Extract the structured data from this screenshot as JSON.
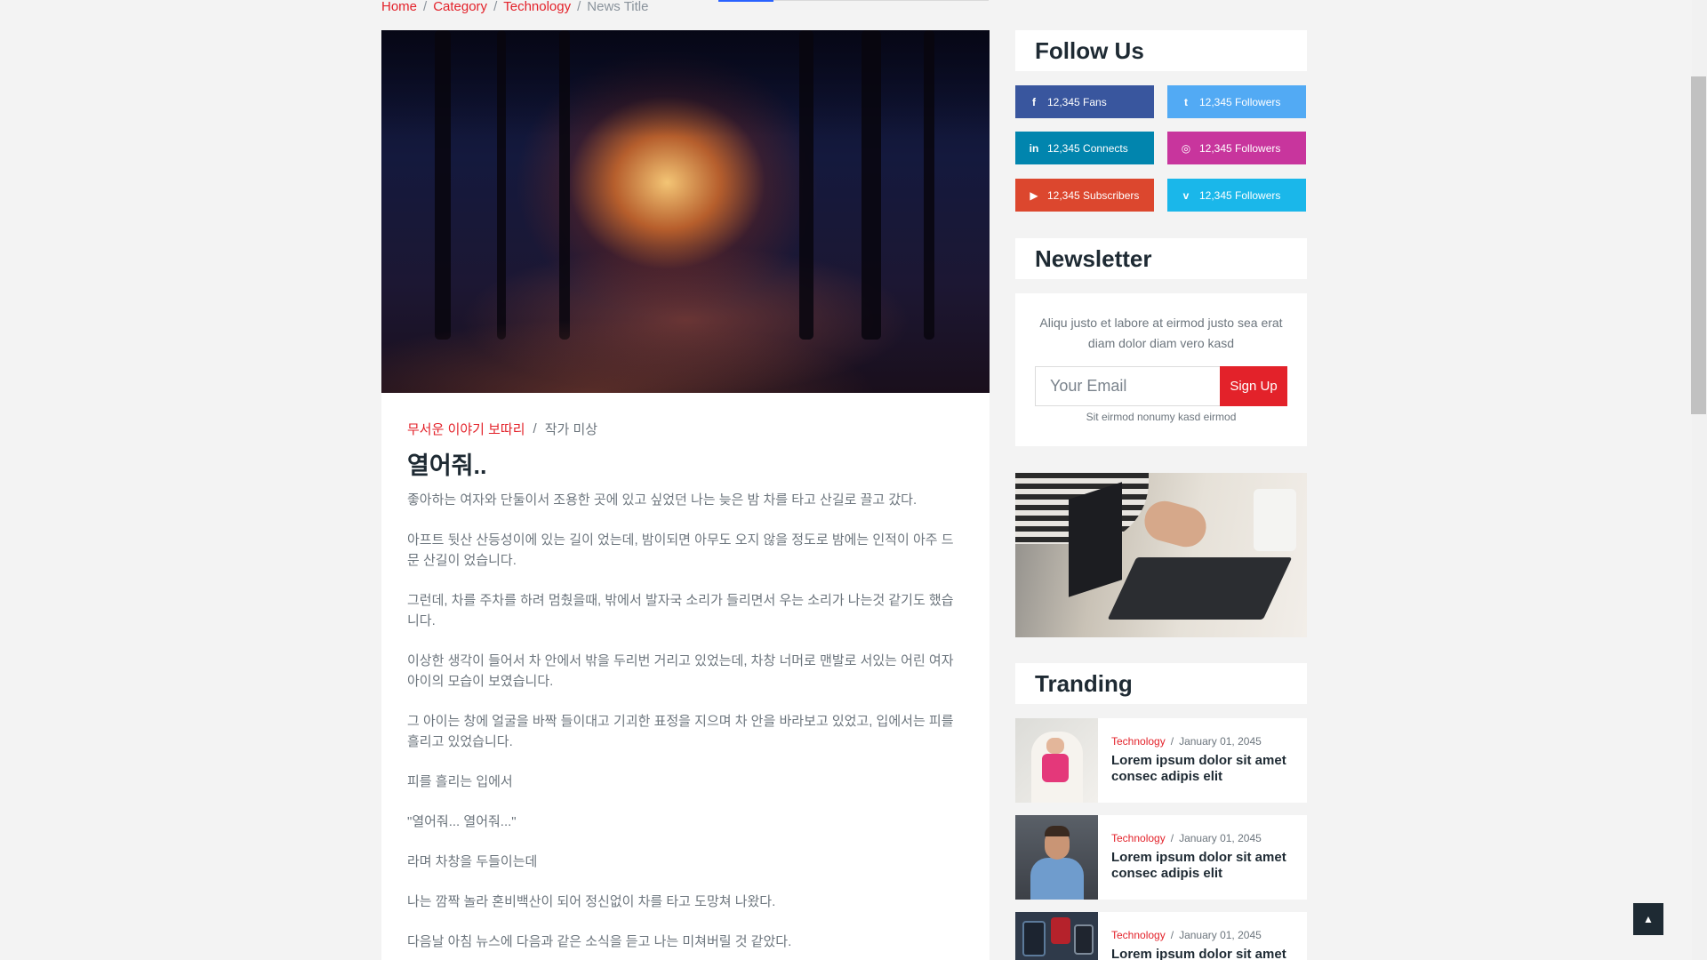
{
  "breadcrumb": {
    "home": "Home",
    "category": "Category",
    "technology": "Technology",
    "current": "News Title",
    "separator": "/"
  },
  "article": {
    "category": "무서운 이야기 보따리",
    "author": "작가 미상",
    "separator": "/",
    "title": "열어줘..",
    "paragraphs": [
      "좋아하는 여자와 단둘이서 조용한 곳에 있고 싶었던 나는 늦은 밤 차를 타고 산길로 끌고 갔다.",
      "아프트 뒷산 산등성이에 있는 길이 었는데, 밤이되면 아무도 오지 않을 정도로 밤에는 인적이 아주 드문 산길이 었습니다.",
      "그런데, 차를 주차를 하려 멈췄을때, 밖에서 발자국 소리가 들리면서 우는 소리가 나는것 같기도 했습니다.",
      "이상한 생각이 들어서 차 안에서 밖을 두리번 거리고 있었는데, 차창 너머로 맨발로 서있는 어린 여자아이의 모습이 보였습니다.",
      "그 아이는 창에 얼굴을 바짝 들이대고 기괴한 표정을 지으며 차 안을 바라보고 있었고, 입에서는 피를 흘리고 있었습니다.",
      "피를 흘리는 입에서",
      "\"열어줘... 열어줘...\"",
      "라며 차창을 두들이는데",
      "나는 깜짝 놀라 혼비백산이 되어 정신없이 차를 타고 도망쳐 나왔다.",
      "다음날 아침 뉴스에 다음과 같은 소식을 듣고 나는 미쳐버릴 것 같았다."
    ]
  },
  "follow": {
    "title": "Follow Us",
    "items": [
      {
        "icon": "facebook-icon",
        "glyph": "f",
        "label": "12,345 Fans",
        "color": "#39569e"
      },
      {
        "icon": "twitter-icon",
        "glyph": "t",
        "label": "12,345 Followers",
        "color": "#52aaf4"
      },
      {
        "icon": "linkedin-icon",
        "glyph": "in",
        "label": "12,345 Connects",
        "color": "#0185ae"
      },
      {
        "icon": "instagram-icon",
        "glyph": "◎",
        "label": "12,345 Followers",
        "color": "#c8359d"
      },
      {
        "icon": "youtube-icon",
        "glyph": "▶",
        "label": "12,345 Subscribers",
        "color": "#dc472e"
      },
      {
        "icon": "vimeo-icon",
        "glyph": "v",
        "label": "12,345 Followers",
        "color": "#1ab7ea"
      }
    ]
  },
  "newsletter": {
    "title": "Newsletter",
    "text": "Aliqu justo et labore at eirmod justo sea erat diam dolor diam vero kasd",
    "placeholder": "Your Email",
    "button": "Sign Up",
    "note": "Sit eirmod nonumy kasd eirmod"
  },
  "trending": {
    "title": "Tranding",
    "items": [
      {
        "category": "Technology",
        "date": "January 01, 2045",
        "title": "Lorem ipsum dolor sit amet consec adipis elit"
      },
      {
        "category": "Technology",
        "date": "January 01, 2045",
        "title": "Lorem ipsum dolor sit amet consec adipis elit"
      },
      {
        "category": "Technology",
        "date": "January 01, 2045",
        "title": "Lorem ipsum dolor sit amet"
      }
    ],
    "separator": "/"
  },
  "back_to_top": {
    "icon": "chevron-up-icon",
    "glyph": "▲"
  },
  "colors": {
    "accent": "#e3222a",
    "dark": "#1e2a33"
  }
}
